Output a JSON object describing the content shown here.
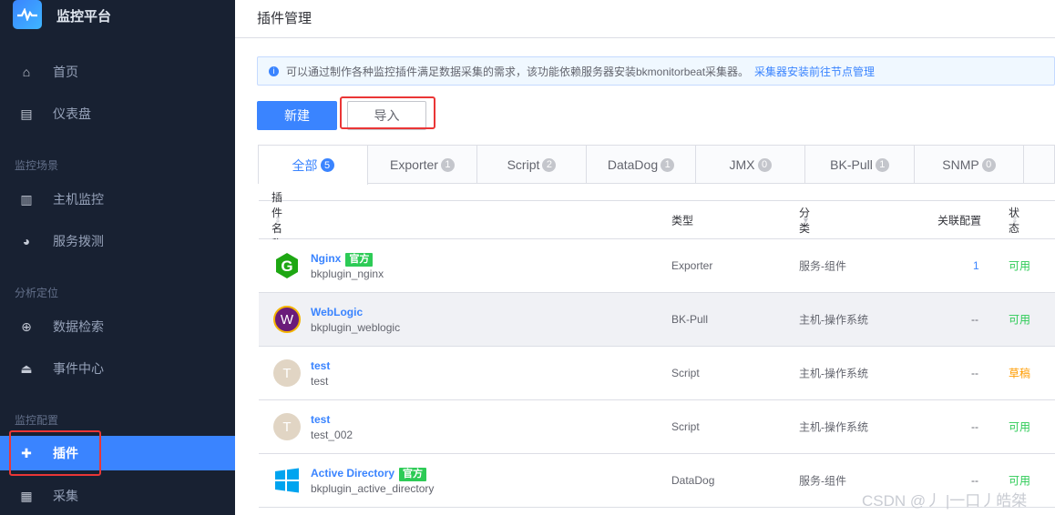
{
  "sidebar": {
    "brand": "监控平台",
    "items": [
      {
        "label": "首页",
        "icon": "home-icon"
      },
      {
        "label": "仪表盘",
        "icon": "dashboard-icon"
      },
      {
        "label": "主机监控",
        "icon": "host-icon"
      },
      {
        "label": "服务拨测",
        "icon": "dial-test-icon"
      },
      {
        "label": "数据检索",
        "icon": "data-search-icon"
      },
      {
        "label": "事件中心",
        "icon": "alarm-icon"
      },
      {
        "label": "插件",
        "icon": "puzzle-icon"
      },
      {
        "label": "采集",
        "icon": "collect-icon"
      }
    ],
    "groups": [
      "监控场景",
      "分析定位",
      "监控配置"
    ],
    "active": "插件"
  },
  "header": {
    "title": "插件管理"
  },
  "notice": {
    "text": "可以通过制作各种监控插件满足数据采集的需求，该功能依赖服务器安装bkmonitorbeat采集器。",
    "link": "采集器安装前往节点管理"
  },
  "toolbar": {
    "new_label": "新建",
    "import_label": "导入"
  },
  "tabs": [
    {
      "label": "全部",
      "count": "5"
    },
    {
      "label": "Exporter",
      "count": "1"
    },
    {
      "label": "Script",
      "count": "2"
    },
    {
      "label": "DataDog",
      "count": "1"
    },
    {
      "label": "JMX",
      "count": "0"
    },
    {
      "label": "BK-Pull",
      "count": "1"
    },
    {
      "label": "SNMP",
      "count": "0"
    }
  ],
  "table": {
    "headers": {
      "name": "插件名称",
      "type": "类型",
      "category": "分类",
      "related": "关联配置",
      "status": "状态"
    },
    "rows": [
      {
        "name": "Nginx",
        "official": "官方",
        "id": "bkplugin_nginx",
        "type": "Exporter",
        "category": "服务-组件",
        "related": "1",
        "status": "可用"
      },
      {
        "name": "WebLogic",
        "id": "bkplugin_weblogic",
        "type": "BK-Pull",
        "category": "主机-操作系统",
        "related": "--",
        "status": "可用"
      },
      {
        "name": "test",
        "avatar": "T",
        "id": "test",
        "type": "Script",
        "category": "主机-操作系统",
        "related": "--",
        "status": "草稿"
      },
      {
        "name": "test",
        "avatar": "T",
        "id": "test_002",
        "type": "Script",
        "category": "主机-操作系统",
        "related": "--",
        "status": "可用"
      },
      {
        "name": "Active Directory",
        "official": "官方",
        "id": "bkplugin_active_directory",
        "type": "DataDog",
        "category": "服务-组件",
        "related": "--",
        "status": "可用"
      }
    ]
  },
  "watermark": "CSDN @丿 |一口丿皓桀"
}
